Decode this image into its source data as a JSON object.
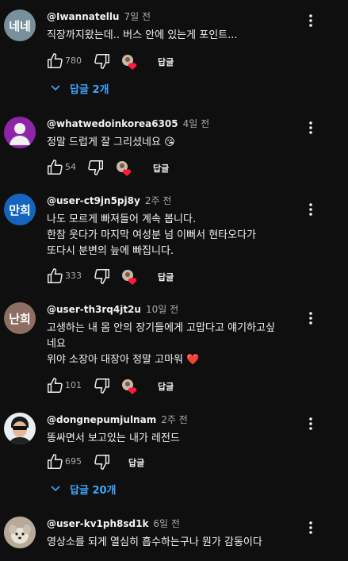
{
  "labels": {
    "reply": "답글"
  },
  "colors": {
    "background": "#0f0f0f",
    "link": "#3ea6ff",
    "meta": "#aaaaaa"
  },
  "comments": [
    {
      "avatar_text": "네네",
      "handle": "@Iwannatellu",
      "time": "7일 전",
      "lines": [
        "직장까지왔는데.. 버스 안에 있는게 포인트..."
      ],
      "likes": "780",
      "replies": "답글 2개"
    },
    {
      "avatar_text": "",
      "handle": "@whatwedoinkorea6305",
      "time": "4일 전",
      "lines": [
        "정말 드럽게 잘 그리셨네요 😘"
      ],
      "likes": "54"
    },
    {
      "avatar_text": "만희",
      "handle": "@user-ct9jn5pj8y",
      "time": "2주 전",
      "lines": [
        "나도 모르게 빠져들어 계속 봅니다.",
        "한참 웃다가 마지막 여성분 넘 이뻐서 현타오다가",
        "또다시 분변의 늪에 빠집니다."
      ],
      "likes": "333"
    },
    {
      "avatar_text": "난희",
      "handle": "@user-th3rq4jt2u",
      "time": "10일 전",
      "lines": [
        "고생하는 내 몸 안의 장기들에게 고맙다고 얘기하고싶",
        "네요",
        "위야 소장아 대장아 정말 고마워 ❤️"
      ],
      "likes": "101"
    },
    {
      "avatar_text": "",
      "handle": "@dongnepumjulnam",
      "time": "2주 전",
      "lines": [
        "똥싸면서 보고있는 내가 레전드"
      ],
      "likes": "695",
      "replies": "답글 20개"
    },
    {
      "avatar_text": "",
      "handle": "@user-kv1ph8sd1k",
      "time": "6일 전",
      "lines": [
        "영상소를 되게 열심히 흡수하는구나 뭔가 감동이다"
      ]
    }
  ]
}
